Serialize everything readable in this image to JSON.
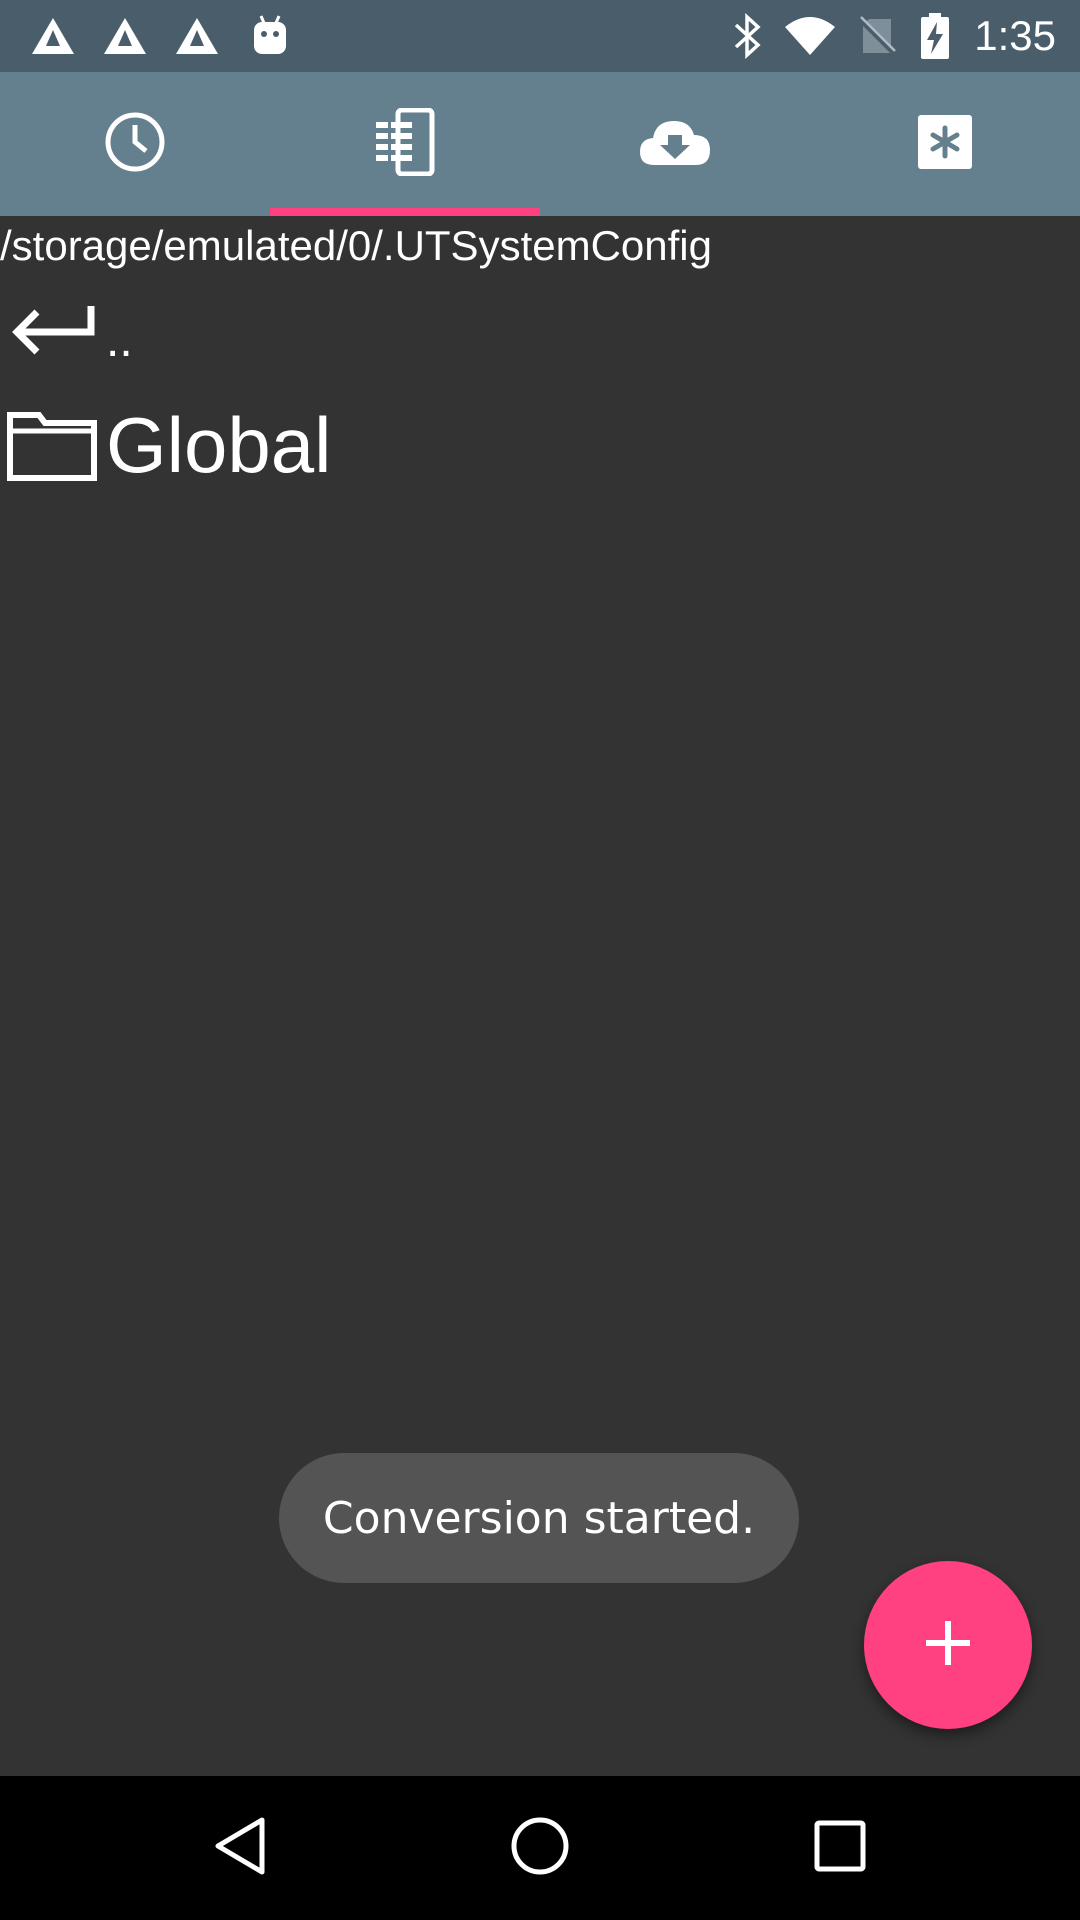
{
  "status_bar": {
    "time": "1:35",
    "left_icons": [
      "warning-triangle-icon",
      "warning-triangle-icon",
      "warning-triangle-icon",
      "android-icon"
    ],
    "right_icons": [
      "bluetooth-icon",
      "wifi-icon",
      "no-sim-icon",
      "battery-charging-icon"
    ]
  },
  "tabs": [
    {
      "icon": "clock-icon",
      "selected": false
    },
    {
      "icon": "phone-files-icon",
      "selected": true
    },
    {
      "icon": "cloud-download-icon",
      "selected": false
    },
    {
      "icon": "asterisk-box-icon",
      "selected": false
    }
  ],
  "browser": {
    "path": "/storage/emulated/0/.UTSystemConfig",
    "items": [
      {
        "icon": "back-arrow-icon",
        "label": ".."
      },
      {
        "icon": "folder-icon",
        "label": "Global"
      }
    ]
  },
  "toast": {
    "text": "Conversion started."
  },
  "fab": {
    "icon": "plus-icon"
  },
  "nav_bar": {
    "buttons": [
      "back-icon",
      "home-icon",
      "recents-icon"
    ]
  },
  "colors": {
    "status_bar": "#4a5d6a",
    "tab_bar": "#647f8d",
    "background": "#333333",
    "accent": "#ff4081",
    "toast": "#545454",
    "nav_bar": "#000000"
  }
}
